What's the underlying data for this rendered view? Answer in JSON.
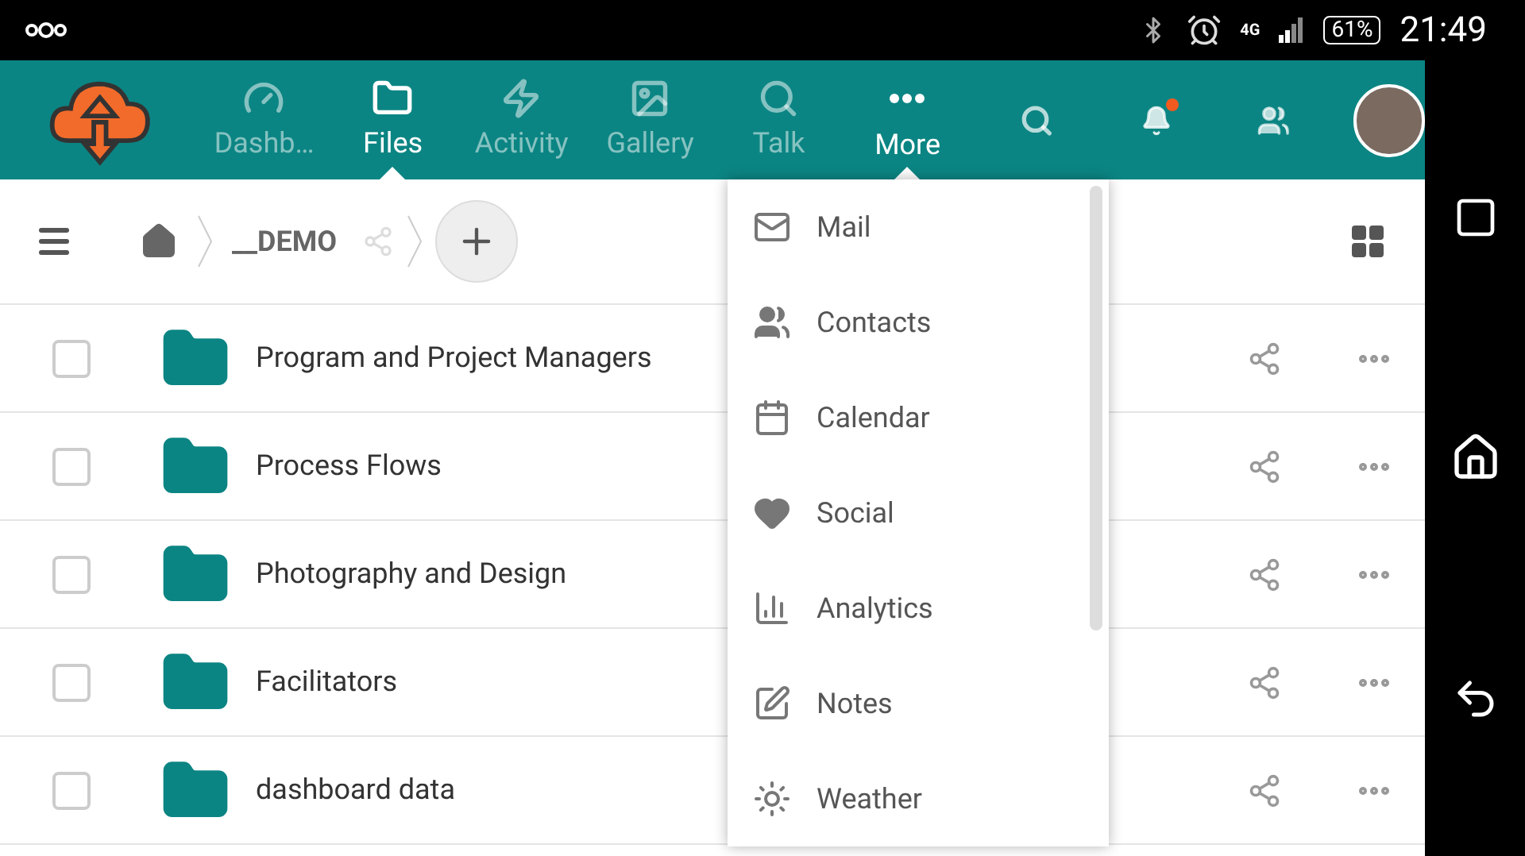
{
  "status_bar": {
    "network": "4G",
    "battery": "61%",
    "time": "21:49"
  },
  "nav": [
    {
      "kind": "dashboard",
      "label": "Dashb…",
      "selected": false
    },
    {
      "kind": "files",
      "label": "Files",
      "selected": true
    },
    {
      "kind": "activity",
      "label": "Activity",
      "selected": false
    },
    {
      "kind": "gallery",
      "label": "Gallery",
      "selected": false
    },
    {
      "kind": "talk",
      "label": "Talk",
      "selected": false
    },
    {
      "kind": "more",
      "label": "More",
      "selected": true
    }
  ],
  "header_actions": {
    "notification": true
  },
  "breadcrumb": {
    "folder": "__DEMO"
  },
  "files": [
    {
      "name": "Program and Project Managers",
      "checked": false
    },
    {
      "name": "Process Flows",
      "checked": false
    },
    {
      "name": "Photography and Design",
      "checked": false
    },
    {
      "name": "Facilitators",
      "checked": false
    },
    {
      "name": "dashboard data",
      "checked": false
    }
  ],
  "more_menu": [
    {
      "kind": "mail",
      "label": "Mail"
    },
    {
      "kind": "contacts",
      "label": "Contacts"
    },
    {
      "kind": "calendar",
      "label": "Calendar"
    },
    {
      "kind": "social",
      "label": "Social"
    },
    {
      "kind": "analytics",
      "label": "Analytics"
    },
    {
      "kind": "notes",
      "label": "Notes"
    },
    {
      "kind": "weather",
      "label": "Weather"
    }
  ]
}
